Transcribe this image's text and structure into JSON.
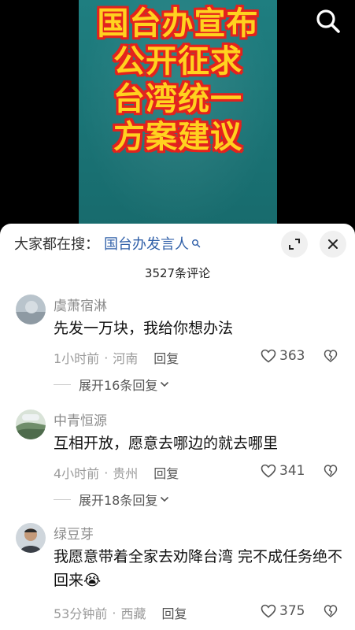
{
  "video": {
    "caption_lines": [
      "国台办宣布",
      "公开征求",
      "台湾统一",
      "方案建议"
    ],
    "search_icon": "search-icon"
  },
  "sheet": {
    "trending_prefix": "大家都在搜：",
    "trending_query": "国台办发言人",
    "trending_icon": "search-icon",
    "expand_icon": "expand-icon",
    "close_icon": "close-icon",
    "comment_count": "3527条评论"
  },
  "comments": [
    {
      "username": "虞萧宿淋",
      "text": "先发一万块，我给你想办法",
      "time": "1小时前",
      "location": "河南",
      "reply_label": "回复",
      "likes": "363",
      "expand_label": "展开16条回复"
    },
    {
      "username": "中青恒源",
      "text": "互相开放，愿意去哪边的就去哪里",
      "time": "4小时前",
      "location": "贵州",
      "reply_label": "回复",
      "likes": "341",
      "expand_label": "展开18条回复"
    },
    {
      "username": "绿豆芽",
      "text": "我愿意带着全家去劝降台湾  完不成任务绝不回来😭",
      "time": "53分钟前",
      "location": "西藏",
      "reply_label": "回复",
      "likes": "375"
    }
  ],
  "colors": {
    "caption_fill": "#ffd21f",
    "caption_outline": "#e3221e",
    "link": "#2f5fa8",
    "meta_text": "#9a9a9a"
  }
}
